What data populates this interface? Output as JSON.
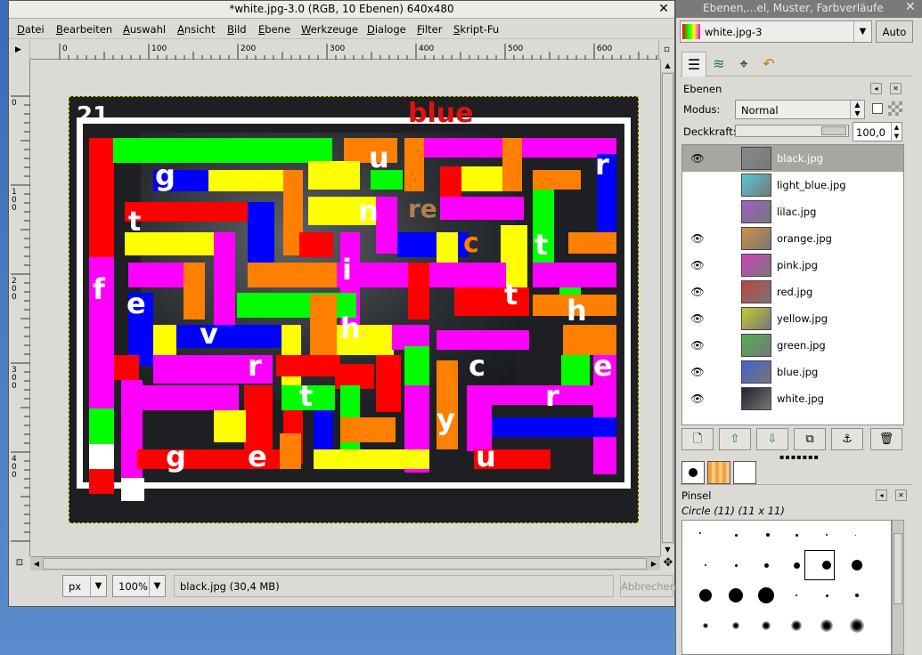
{
  "window": {
    "title": "*white.jpg-3.0 (RGB, 10 Ebenen) 640x480",
    "close_glyph": "✕"
  },
  "menu": [
    "Datei",
    "Bearbeiten",
    "Auswahl",
    "Ansicht",
    "Bild",
    "Ebene",
    "Werkzeuge",
    "Dialoge",
    "Filter",
    "Skript-Fu"
  ],
  "ruler": {
    "h_labels": [
      "0",
      "100",
      "200",
      "300",
      "400",
      "500",
      "600"
    ],
    "v_labels": [
      "0",
      "100",
      "200",
      "300",
      "400"
    ]
  },
  "statusbar": {
    "unit": "px",
    "zoom": "100%",
    "message": "black.jpg (30,4 MB)",
    "abort_label": "Abbrechen"
  },
  "canvas_letters": [
    {
      "t": "21"
    },
    {
      "t": "g"
    },
    {
      "t": "u"
    },
    {
      "t": "r"
    },
    {
      "t": "t"
    },
    {
      "t": "n"
    },
    {
      "t": "t"
    },
    {
      "t": "f"
    },
    {
      "t": "i"
    },
    {
      "t": "e"
    },
    {
      "t": "t"
    },
    {
      "t": "h"
    },
    {
      "t": "v"
    },
    {
      "t": "h"
    },
    {
      "t": "r"
    },
    {
      "t": "c"
    },
    {
      "t": "e"
    },
    {
      "t": "t"
    },
    {
      "t": "r"
    },
    {
      "t": "y"
    },
    {
      "t": "g"
    },
    {
      "t": "e"
    },
    {
      "t": "u"
    }
  ],
  "canvas_ghost_words": [
    {
      "t": "blue",
      "color": "#e41010"
    },
    {
      "t": "c",
      "color": "#ff7f00"
    },
    {
      "t": "re",
      "color": "#b08050"
    }
  ],
  "colors": {
    "green": "#00ff00",
    "red": "#ff0000",
    "yellow": "#ffff00",
    "magenta": "#ff00ff",
    "orange": "#ff7f00",
    "blue": "#0000ff",
    "white": "#ffffff"
  },
  "dock": {
    "title": "Ebenen,...el, Muster, Farbverläufe",
    "image_select": "white.jpg-3",
    "auto_label": "Auto",
    "tab_icons": [
      "layers-icon",
      "channels-icon",
      "paths-icon",
      "undo-history-icon"
    ],
    "layers_panel": {
      "title": "Ebenen",
      "mode_label": "Modus:",
      "mode_value": "Normal",
      "opacity_label": "Deckkraft:",
      "opacity_value": "100,0",
      "opacity_fraction": 1.0
    },
    "layers": [
      {
        "name": "black.jpg",
        "visible": true,
        "selected": true,
        "thumb": "#8a8a8a"
      },
      {
        "name": "light_blue.jpg",
        "visible": false,
        "selected": false,
        "thumb": "#55c8d8"
      },
      {
        "name": "lilac.jpg",
        "visible": false,
        "selected": false,
        "thumb": "#9a60c8"
      },
      {
        "name": "orange.jpg",
        "visible": true,
        "selected": false,
        "thumb": "#d09040"
      },
      {
        "name": "pink.jpg",
        "visible": true,
        "selected": false,
        "thumb": "#d040c0"
      },
      {
        "name": "red.jpg",
        "visible": true,
        "selected": false,
        "thumb": "#c04040"
      },
      {
        "name": "yellow.jpg",
        "visible": true,
        "selected": false,
        "thumb": "#c8c830"
      },
      {
        "name": "green.jpg",
        "visible": true,
        "selected": false,
        "thumb": "#50b050"
      },
      {
        "name": "blue.jpg",
        "visible": true,
        "selected": false,
        "thumb": "#4060d0"
      },
      {
        "name": "white.jpg",
        "visible": true,
        "selected": false,
        "thumb": "#223"
      }
    ],
    "layer_buttons": [
      "new-layer",
      "raise-layer",
      "lower-layer",
      "duplicate-layer",
      "anchor-layer",
      "delete-layer"
    ],
    "brushes_panel": {
      "title": "Pinsel",
      "current": "Circle (11) (11 x 11)"
    }
  }
}
